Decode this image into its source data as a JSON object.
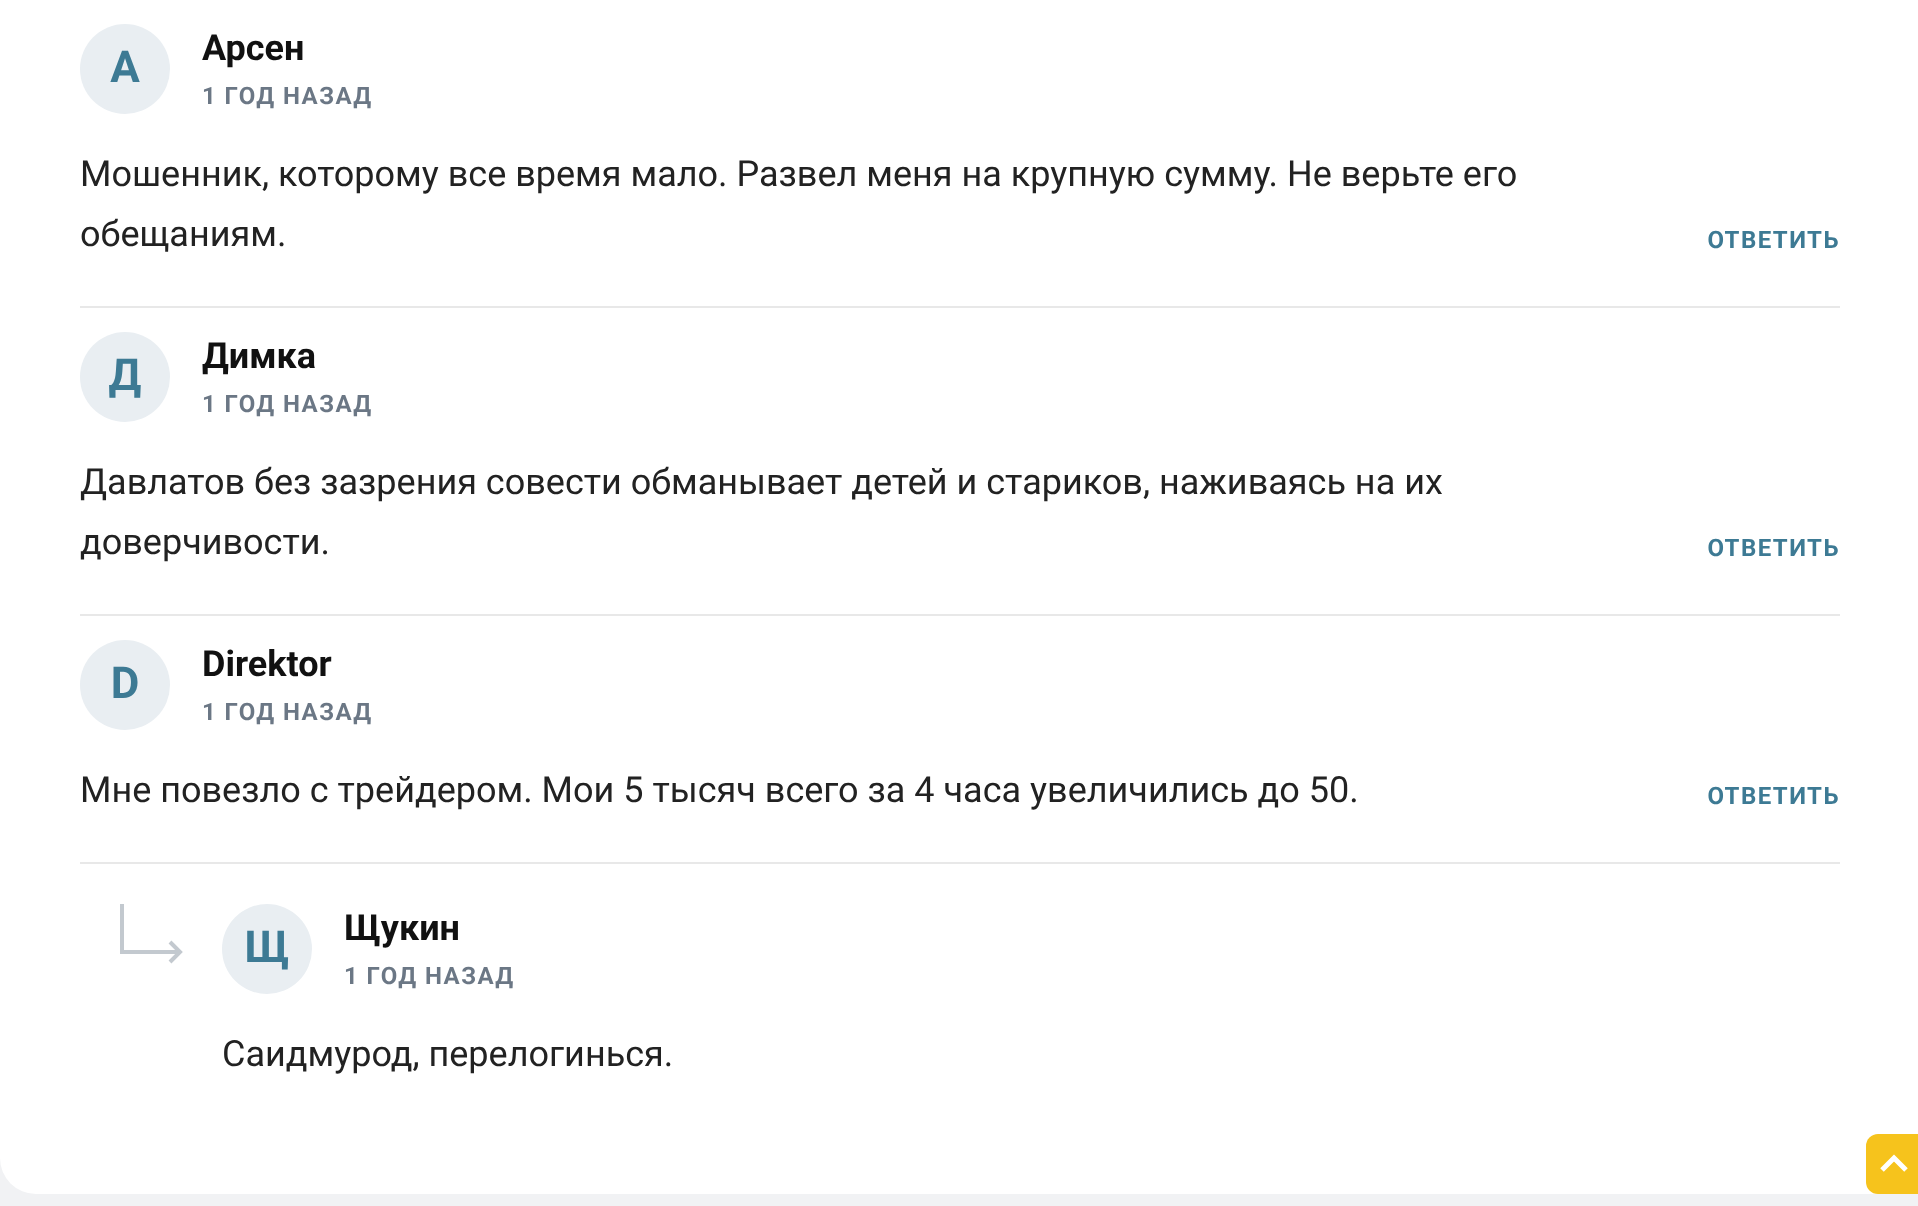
{
  "comments": [
    {
      "initial": "А",
      "name": "Арсен",
      "date": "1 ГОД НАЗАД",
      "text": "Мошенник, которому все время мало. Развел меня на крупную сумму. Не верьте его обещаниям.",
      "reply_label": "ОТВЕТИТЬ"
    },
    {
      "initial": "Д",
      "name": "Димка",
      "date": "1 ГОД НАЗАД",
      "text": "Давлатов без зазрения совести обманывает детей и стариков, наживаясь на их доверчивости.",
      "reply_label": "ОТВЕТИТЬ"
    },
    {
      "initial": "D",
      "name": "Direktor",
      "date": "1 ГОД НАЗАД",
      "text": "Мне повезло с трейдером. Мои 5 тысяч всего за 4 часа увеличились до 50.",
      "reply_label": "ОТВЕТИТЬ",
      "children": [
        {
          "initial": "Щ",
          "name": "Щукин",
          "date": "1 ГОД НАЗАД",
          "text": "Саидмурод, перелогинься."
        }
      ]
    }
  ]
}
